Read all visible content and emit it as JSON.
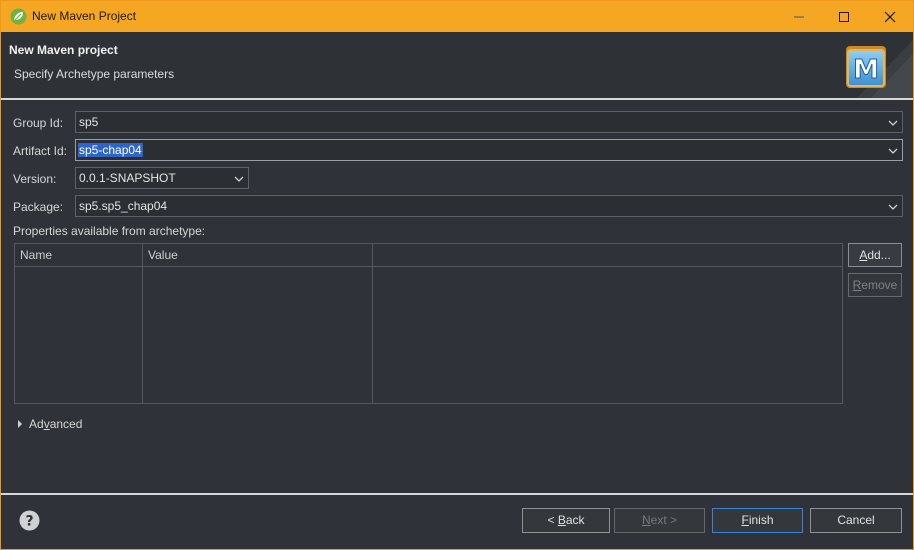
{
  "window": {
    "title": "New Maven Project",
    "accent_color": "#f5a623",
    "icons": {
      "app": "spring-leaf-icon",
      "minimize": "minimize-icon",
      "maximize": "maximize-icon",
      "close": "close-icon"
    }
  },
  "header": {
    "title": "New Maven project",
    "subtitle": "Specify Archetype parameters",
    "logo_letter": "M"
  },
  "form": {
    "group_id": {
      "label": "Group Id:",
      "value": "sp5"
    },
    "artifact_id": {
      "label": "Artifact Id:",
      "value": "sp5-chap04"
    },
    "version": {
      "label": "Version:",
      "value": "0.0.1-SNAPSHOT"
    },
    "package": {
      "label": "Package:",
      "value": "sp5.sp5_chap04"
    },
    "properties_label": "Properties available from archetype:"
  },
  "properties_table": {
    "columns": [
      "Name",
      "Value"
    ],
    "rows": []
  },
  "side_buttons": {
    "add": {
      "prefix": "",
      "mnemonic": "A",
      "rest": "dd..."
    },
    "remove": {
      "prefix": "",
      "mnemonic": "R",
      "rest": "emove"
    }
  },
  "advanced": {
    "prefix": "Ad",
    "mnemonic": "v",
    "rest": "anced"
  },
  "footer": {
    "help_icon": "help-icon",
    "back": {
      "prefix": "< ",
      "mnemonic": "B",
      "rest": "ack"
    },
    "next": {
      "prefix": "",
      "mnemonic": "N",
      "rest": "ext >"
    },
    "finish": {
      "prefix": "",
      "mnemonic": "F",
      "rest": "inish"
    },
    "cancel": {
      "label": "Cancel"
    }
  }
}
